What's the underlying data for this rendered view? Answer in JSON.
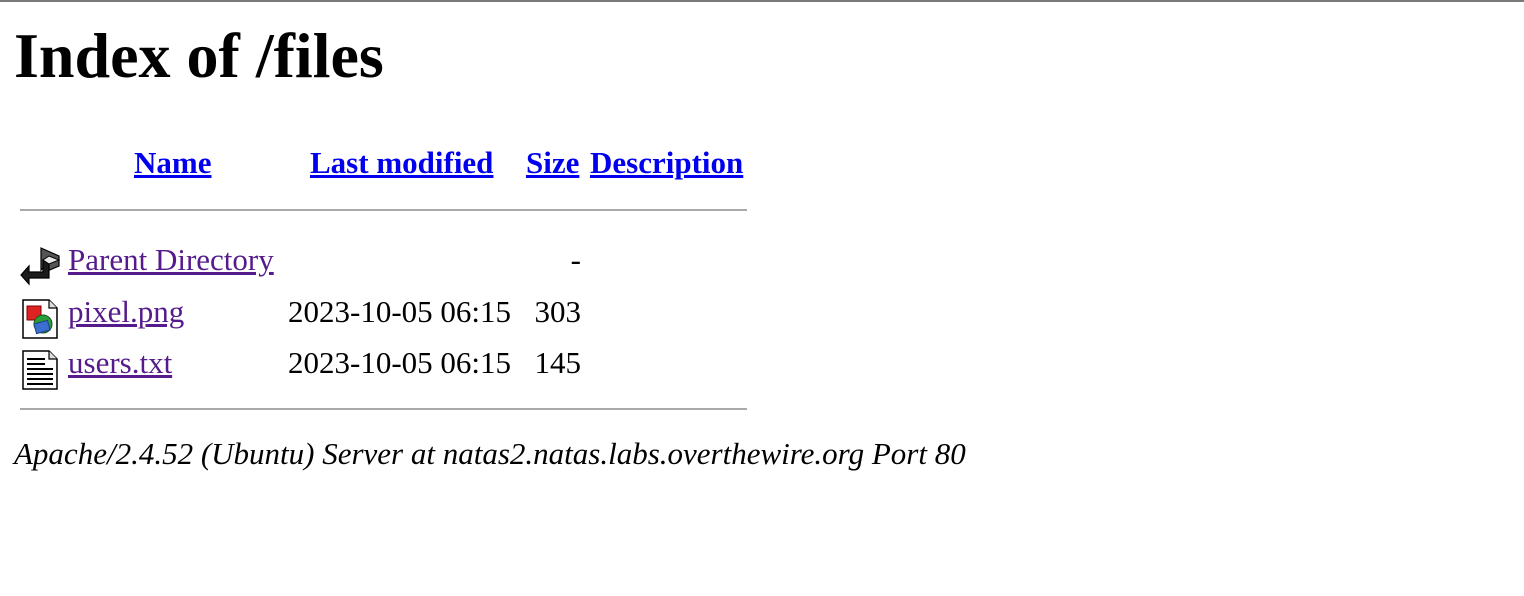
{
  "page": {
    "title": "Index of /files"
  },
  "columns": {
    "name": "Name",
    "last_modified": "Last modified",
    "size": "Size",
    "description": "Description"
  },
  "entries": [
    {
      "name": "Parent Directory",
      "last_modified": "",
      "size": "-",
      "description": "",
      "icon": "back-icon"
    },
    {
      "name": "pixel.png",
      "last_modified": "2023-10-05 06:15",
      "size": "303",
      "description": "",
      "icon": "image-file-icon"
    },
    {
      "name": "users.txt",
      "last_modified": "2023-10-05 06:15",
      "size": "145",
      "description": "",
      "icon": "text-file-icon"
    }
  ],
  "footer": {
    "address": "Apache/2.4.52 (Ubuntu) Server at natas2.natas.labs.overthewire.org Port 80"
  },
  "colors": {
    "link": "#0000ee",
    "visited_link": "#551a8b",
    "rule": "#a9a9a9"
  }
}
